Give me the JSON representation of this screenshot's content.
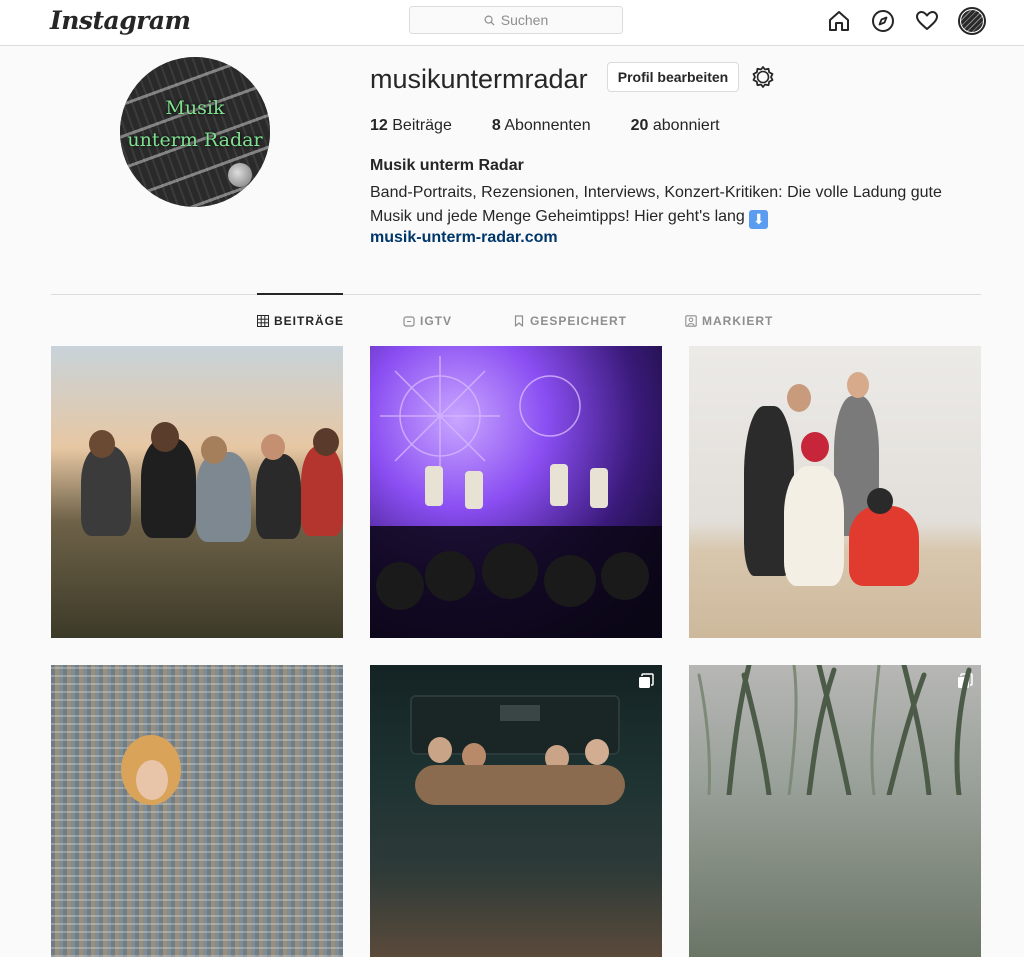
{
  "nav": {
    "logo": "Instagram",
    "search_placeholder": "Suchen",
    "icons": [
      "home-icon",
      "explore-icon",
      "activity-heart-icon",
      "profile-avatar"
    ]
  },
  "profile": {
    "username": "musikuntermradar",
    "edit_button": "Profil bearbeiten",
    "stats": [
      {
        "count": "12",
        "label": "Beiträge"
      },
      {
        "count": "8",
        "label": "Abonnenten"
      },
      {
        "count": "20",
        "label": "abonniert"
      }
    ],
    "full_name": "Musik unterm Radar",
    "bio_line1": "Band-Portraits, Rezensionen, Interviews, Konzert-Kritiken: Die volle Ladung gute",
    "bio_line2": "Musik und jede Menge Geheimtipps! Hier geht's lang",
    "bio_emoji": "⬇",
    "link": "musik-unterm-radar.com",
    "avatar_text_1": "Musik",
    "avatar_text_2": "unterm Radar"
  },
  "tabs": [
    {
      "label": "BEITRÄGE",
      "icon": "grid-icon",
      "active": true
    },
    {
      "label": "IGTV",
      "icon": "igtv-icon",
      "active": false
    },
    {
      "label": "GESPEICHERT",
      "icon": "bookmark-icon",
      "active": false
    },
    {
      "label": "MARKIERT",
      "icon": "tagged-icon",
      "active": false
    }
  ],
  "colors": {
    "link": "#00376b",
    "text": "#262626",
    "muted": "#8e8e8e",
    "border": "#dbdbdb"
  }
}
